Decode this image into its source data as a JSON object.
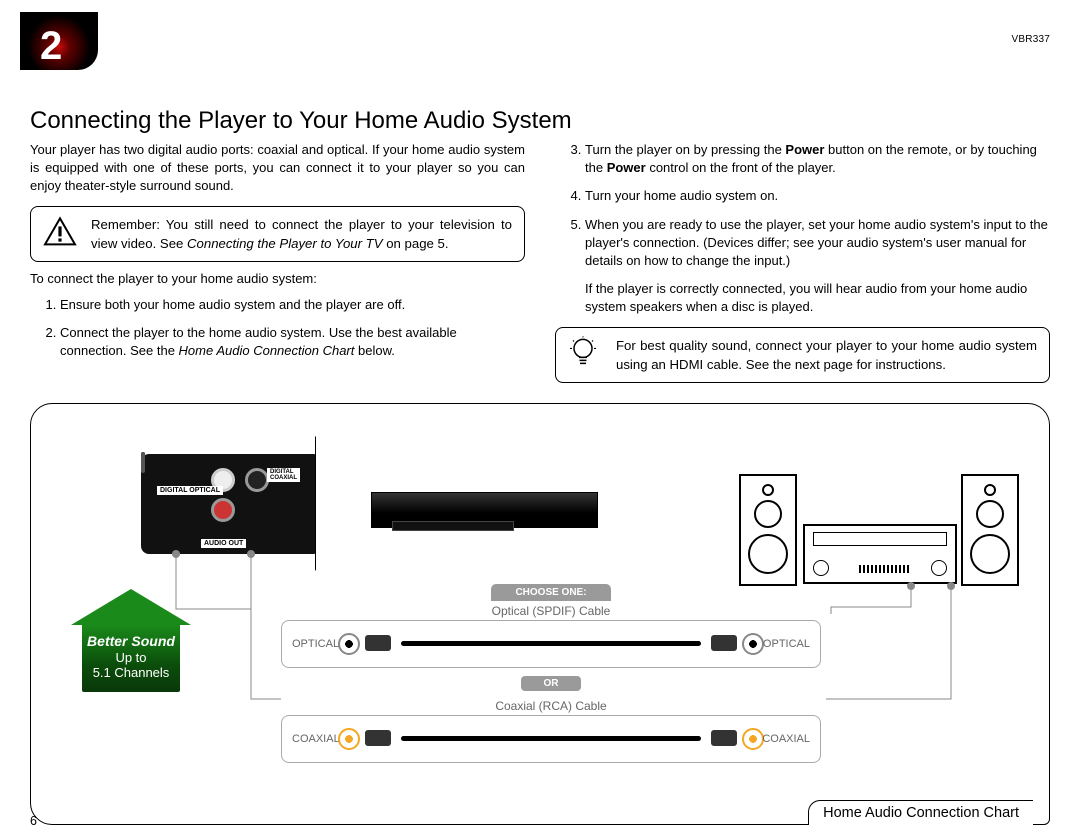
{
  "chapter_number": "2",
  "model": "VBR337",
  "title": "Connecting the Player to Your Home Audio System",
  "intro": "Your player has two digital audio ports: coaxial and optical. If your home audio system is equipped with one of these ports, you can connect it to your player so you can enjoy theater-style surround sound.",
  "warn_callout_pre": "Remember: You still need to connect the player to your television to view video. See ",
  "warn_callout_em": "Connecting the Player to Your TV",
  "warn_callout_post": " on page 5.",
  "lead": "To connect the player to your home audio system:",
  "step1": "Ensure both your home audio system and the player are off.",
  "step2_pre": "Connect the player to the home audio system. Use the best available connection. See the ",
  "step2_em": "Home Audio Connection Chart",
  "step2_post": " below.",
  "step3_pre": "Turn the player on by pressing the ",
  "step3_b1": "Power",
  "step3_mid": " button on the remote, or by touching the ",
  "step3_b2": "Power",
  "step3_post": " control on the front of the player.",
  "step4": "Turn your home audio system on.",
  "step5": "When you are ready to use the player, set your home audio system's input to the player's connection. (Devices differ; see your audio system's user manual for details on how to change the input.)",
  "step5_tail": "If the player is correctly connected, you will hear audio from your home audio system speakers when a disc is played.",
  "tip": "For best quality sound, connect your player to your home audio system using an HDMI cable. See the next page for instructions.",
  "chart_caption": "Home Audio Connection Chart",
  "page_number": "6",
  "arrow": {
    "l1": "Better Sound",
    "l2": "Up to",
    "l3": "5.1 Channels"
  },
  "panel": {
    "audio_out": "AUDIO OUT",
    "digital_optical": "DIGITAL OPTICAL",
    "digital_coax": "DIGITAL\nCOAXIAL"
  },
  "choose": "CHOOSE ONE:",
  "optical_label": "OPTICAL",
  "optical_cable": "Optical (SPDIF) Cable",
  "or": "OR",
  "coax_label": "COAXIAL",
  "coax_cable": "Coaxial (RCA) Cable"
}
